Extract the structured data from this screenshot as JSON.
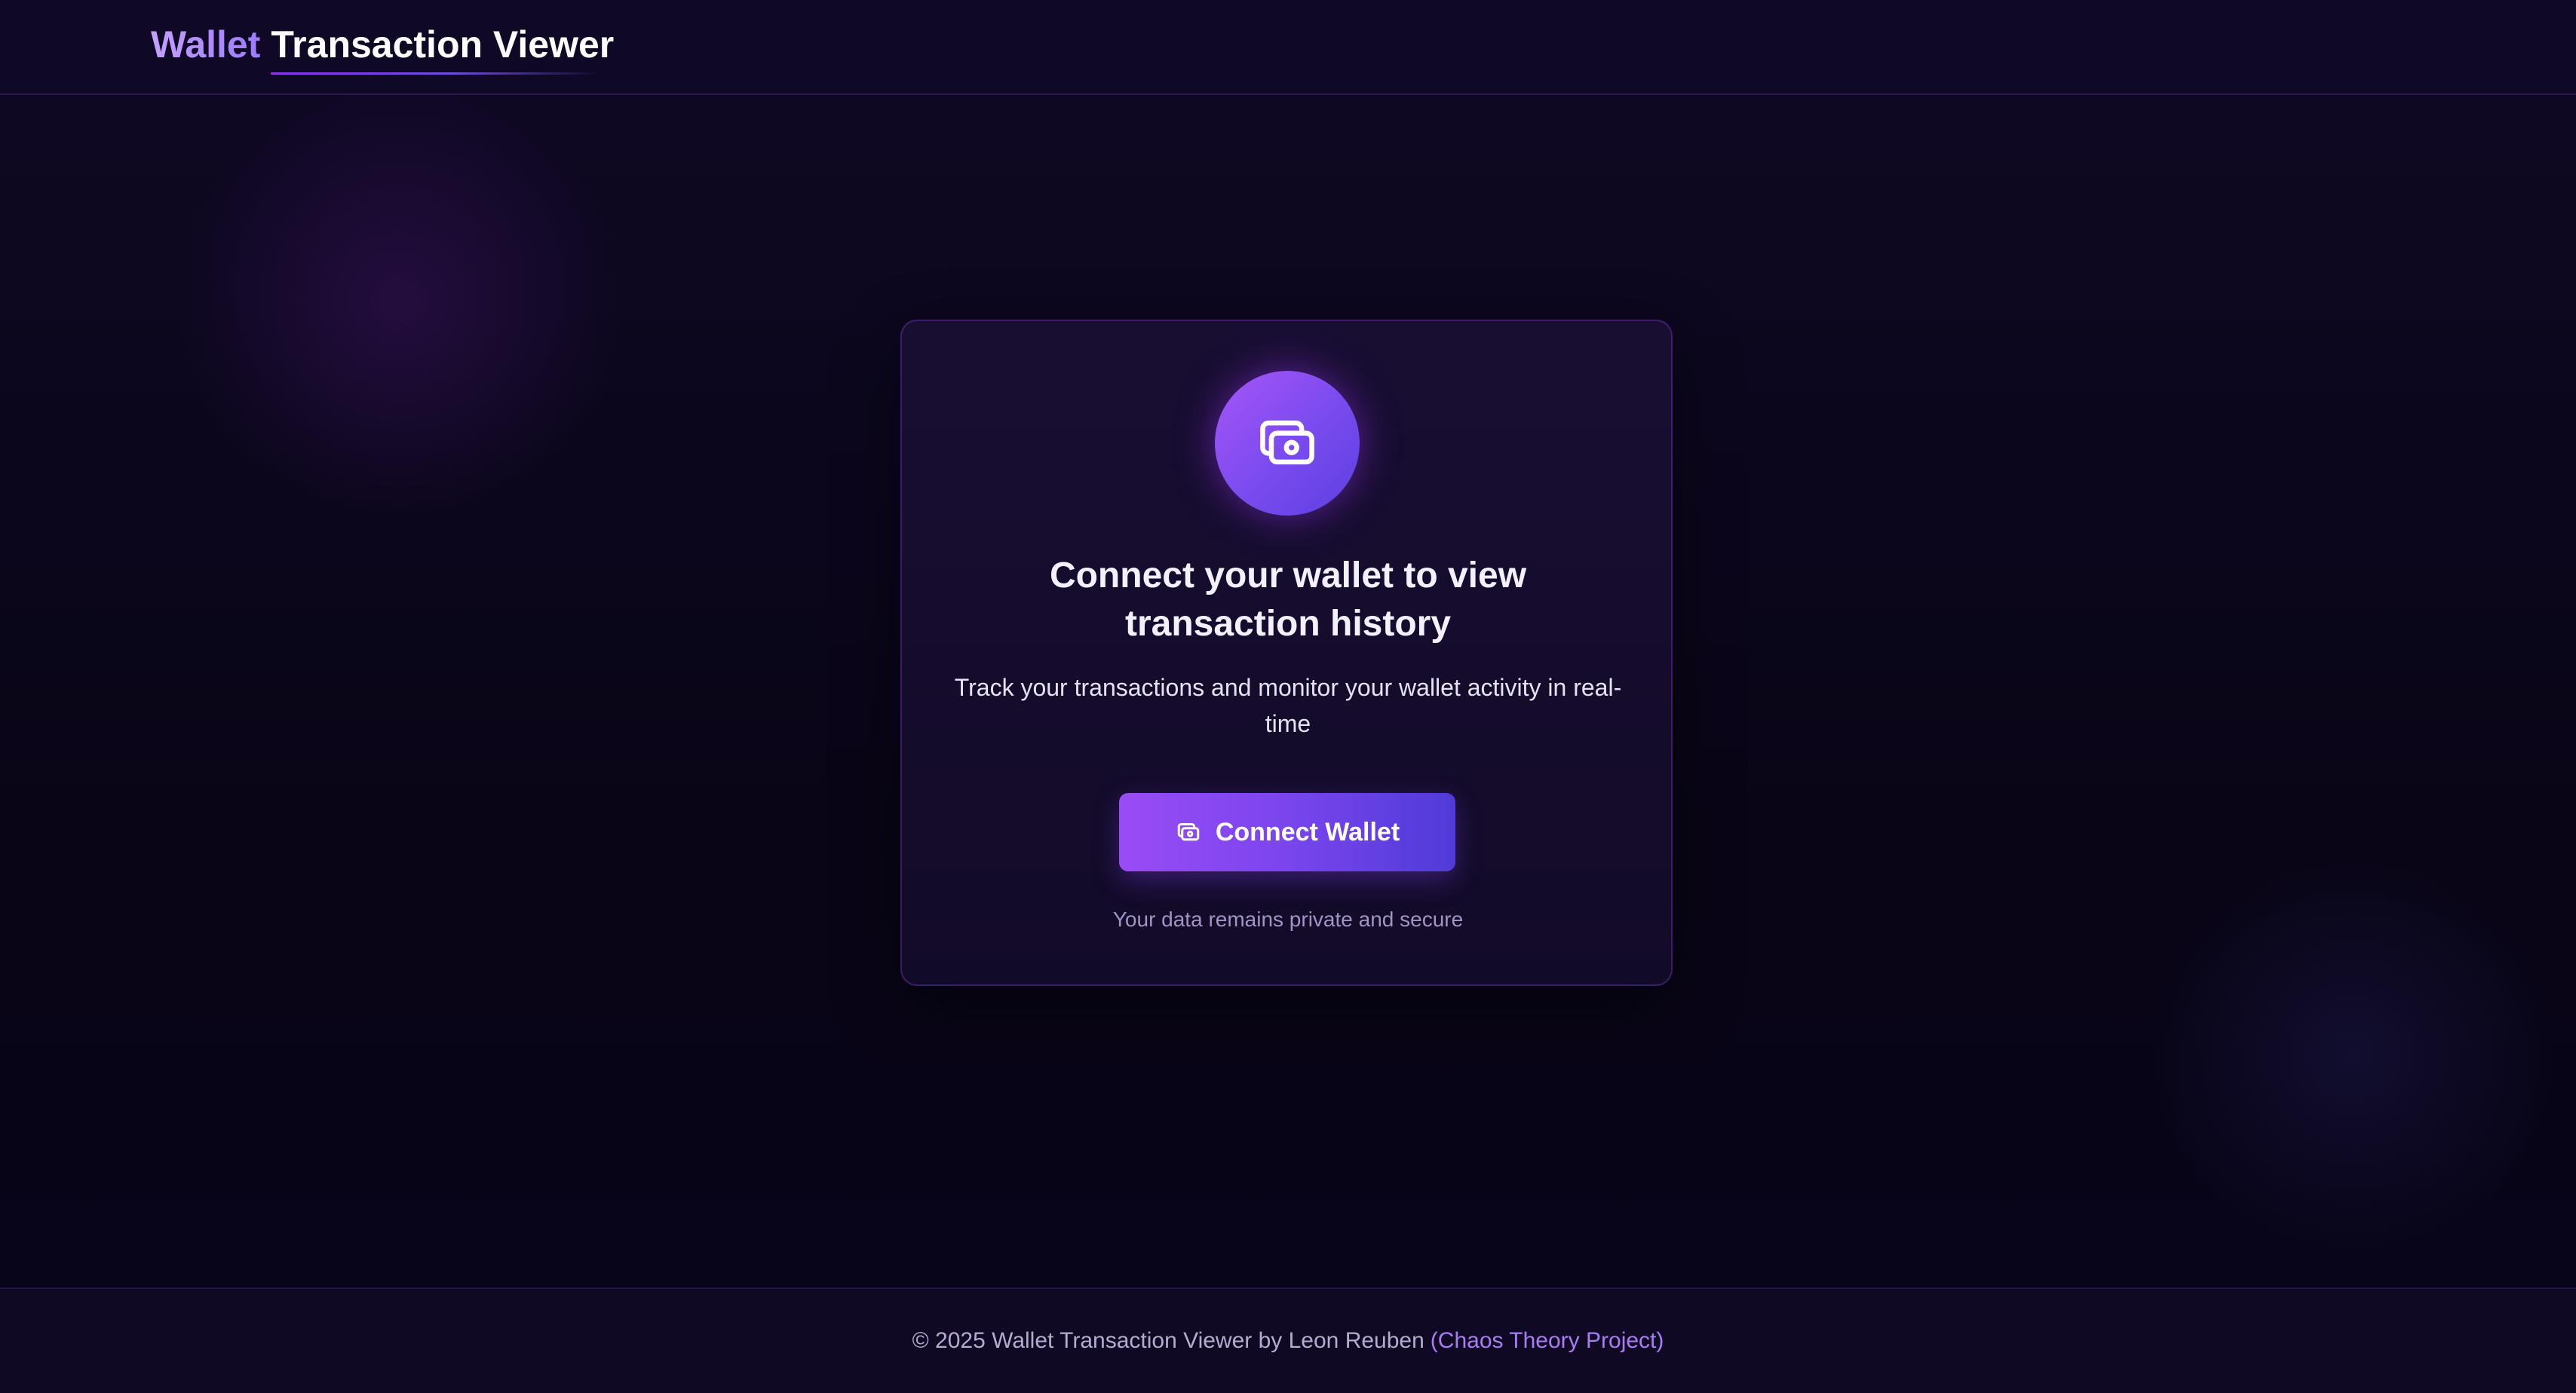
{
  "header": {
    "brand_accent": "Wallet",
    "brand_rest": "Transaction Viewer"
  },
  "card": {
    "icon": "wallet-icon",
    "title": "Connect your wallet to view transaction history",
    "subtitle": "Track your transactions and monitor your wallet activity in real-time",
    "connect_button_label": "Connect Wallet",
    "privacy_note": "Your data remains private and secure"
  },
  "footer": {
    "text": "© 2025 Wallet Transaction Viewer by Leon Reuben",
    "link_text": "(Chaos Theory Project)"
  },
  "colors": {
    "background": "#0b0619",
    "accent_purple": "#a855f7",
    "accent_indigo": "#4f3bd8",
    "link": "#a97cf5"
  }
}
